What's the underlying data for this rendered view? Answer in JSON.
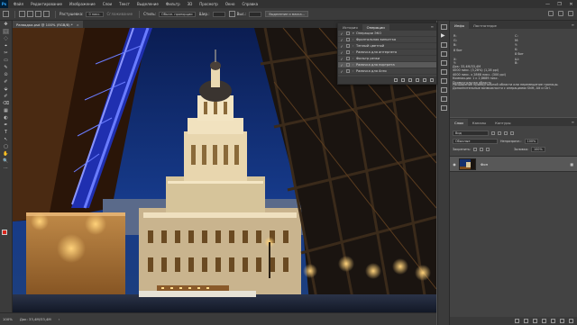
{
  "menubar": {
    "logo": "Ps",
    "items": [
      "Файл",
      "Редактирование",
      "Изображение",
      "Слои",
      "Текст",
      "Выделение",
      "Фильтр",
      "3D",
      "Просмотр",
      "Окно",
      "Справка"
    ],
    "window_controls": [
      "—",
      "❐",
      "✕"
    ]
  },
  "options": {
    "feather_label": "Растушевка:",
    "feather_value": "0 пикс.",
    "antialias_label": "Сглаживание",
    "style_label": "Стиль:",
    "style_value": "Обычн. пропорции",
    "width_label": "Шир.:",
    "height_label": "Выс.:",
    "select_mask_button": "Выделение и маска..."
  },
  "document": {
    "tab_title": "Разводка.psd @ 100% (RGB/8) *",
    "close": "×"
  },
  "statusbar": {
    "zoom": "100%",
    "doc_info": "Док: 33,4M/33,4M",
    "arrow": "›"
  },
  "actions_panel": {
    "tabs": [
      "История",
      "Операции"
    ],
    "active_tab": 1,
    "menu": "≡",
    "rows": [
      {
        "check": "✓",
        "arrow": "▾",
        "label": "Операции ЭКО",
        "selected": false
      },
      {
        "check": "✓",
        "arrow": "›",
        "label": "Фронтальная виньетка",
        "selected": false
      },
      {
        "check": "✓",
        "arrow": "›",
        "label": "Теплый цветной",
        "selected": false
      },
      {
        "check": "✓",
        "arrow": "›",
        "label": "Рамочка для интернета",
        "selected": false
      },
      {
        "check": "✓",
        "arrow": "›",
        "label": "Фильтр резки",
        "selected": false
      },
      {
        "check": "✓",
        "arrow": "›",
        "label": "Рамочка для портрета",
        "selected": true
      },
      {
        "check": "✓",
        "arrow": "›",
        "label": "Рамочка для Агео",
        "selected": false
      }
    ]
  },
  "info_panel": {
    "tabs": [
      "Инфо",
      "Ластпотерре"
    ],
    "menu": "≡",
    "r_label": "R:",
    "g_label": "G:",
    "b_label": "B:",
    "c_label": "C:",
    "m_label": "M:",
    "y_label": "Y:",
    "k_label": "K:",
    "bit_left": "8 бит",
    "bit_right": "8 бит",
    "x_label": "X:",
    "y2_label": "Y:",
    "w_label": "Ш:",
    "h_label": "В:",
    "lines": [
      "Док: 33,4M/33,4M",
      "4000 пикс. (3,28%) (1,28 ppi)",
      "4000 пикс. х 2868 пикс. (300 ppi)",
      "Компакция: 1 к 2,8689 пикс.",
      "Прямоугольная область"
    ],
    "hint": "Расширение прямоугольной области или перемещение границы. Дополнительные возможности с операциями Shift, Alt и Ctrl."
  },
  "layers_panel": {
    "tabs": [
      "Слои",
      "Каналы",
      "Контуры"
    ],
    "menu": "≡",
    "kind_label": "Вид",
    "blend_mode": "Обычные",
    "opacity_label": "Непрозрачн.:",
    "opacity_value": "100%",
    "lock_label": "Закрепить:",
    "fill_label": "Заливка:",
    "fill_value": "100%",
    "layer_name": "Фон",
    "eye": "👁",
    "lock": "🔒"
  },
  "tools": [
    "▭",
    "✥",
    "⬚",
    "◌",
    "⌖",
    "✎",
    "✂",
    "⊙",
    "✐",
    "⬙",
    "⌫",
    "▦",
    "◐",
    "✒",
    "T",
    "↖",
    "▢",
    "✋",
    "🔍",
    "⋯"
  ]
}
